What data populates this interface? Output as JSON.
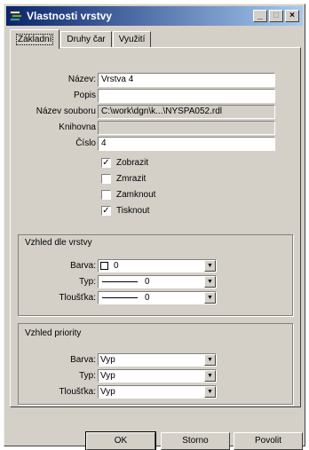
{
  "window": {
    "title": "Vlastnosti vrstvy",
    "minimize": "_",
    "maximize": "□",
    "close": "×"
  },
  "tabs": [
    {
      "label": "Základní",
      "active": true
    },
    {
      "label": "Druhy čar",
      "active": false
    },
    {
      "label": "Využití",
      "active": false
    }
  ],
  "basic": {
    "nazev_label": "Název:",
    "nazev_value": "Vrstva 4",
    "popis_label": "Popis",
    "popis_value": "",
    "soubor_label": "Název souboru",
    "soubor_value": "C:\\work\\dgn\\k...\\NYSPA052.rdl",
    "knihovna_label": "Knihovna",
    "knihovna_value": "",
    "cislo_label": "Číslo",
    "cislo_value": "4"
  },
  "checkboxes": [
    {
      "label": "Zobrazit",
      "checked": true
    },
    {
      "label": "Zmrazit",
      "checked": false
    },
    {
      "label": "Zamknout",
      "checked": false
    },
    {
      "label": "Tisknout",
      "checked": true
    }
  ],
  "layer_view": {
    "title": "Vzhled dle vrstvy",
    "barva_label": "Barva:",
    "barva_value": "0",
    "typ_label": "Typ:",
    "typ_value": "0",
    "tloustka_label": "Tloušťka:",
    "tloustka_value": "0"
  },
  "priority_view": {
    "title": "Vzhled priority",
    "barva_label": "Barva:",
    "barva_value": "Vyp",
    "typ_label": "Typ:",
    "typ_value": "Vyp",
    "tloustka_label": "Tloušťka:",
    "tloustka_value": "Vyp"
  },
  "buttons": {
    "ok": "OK",
    "storno": "Storno",
    "povolit": "Povolit"
  }
}
